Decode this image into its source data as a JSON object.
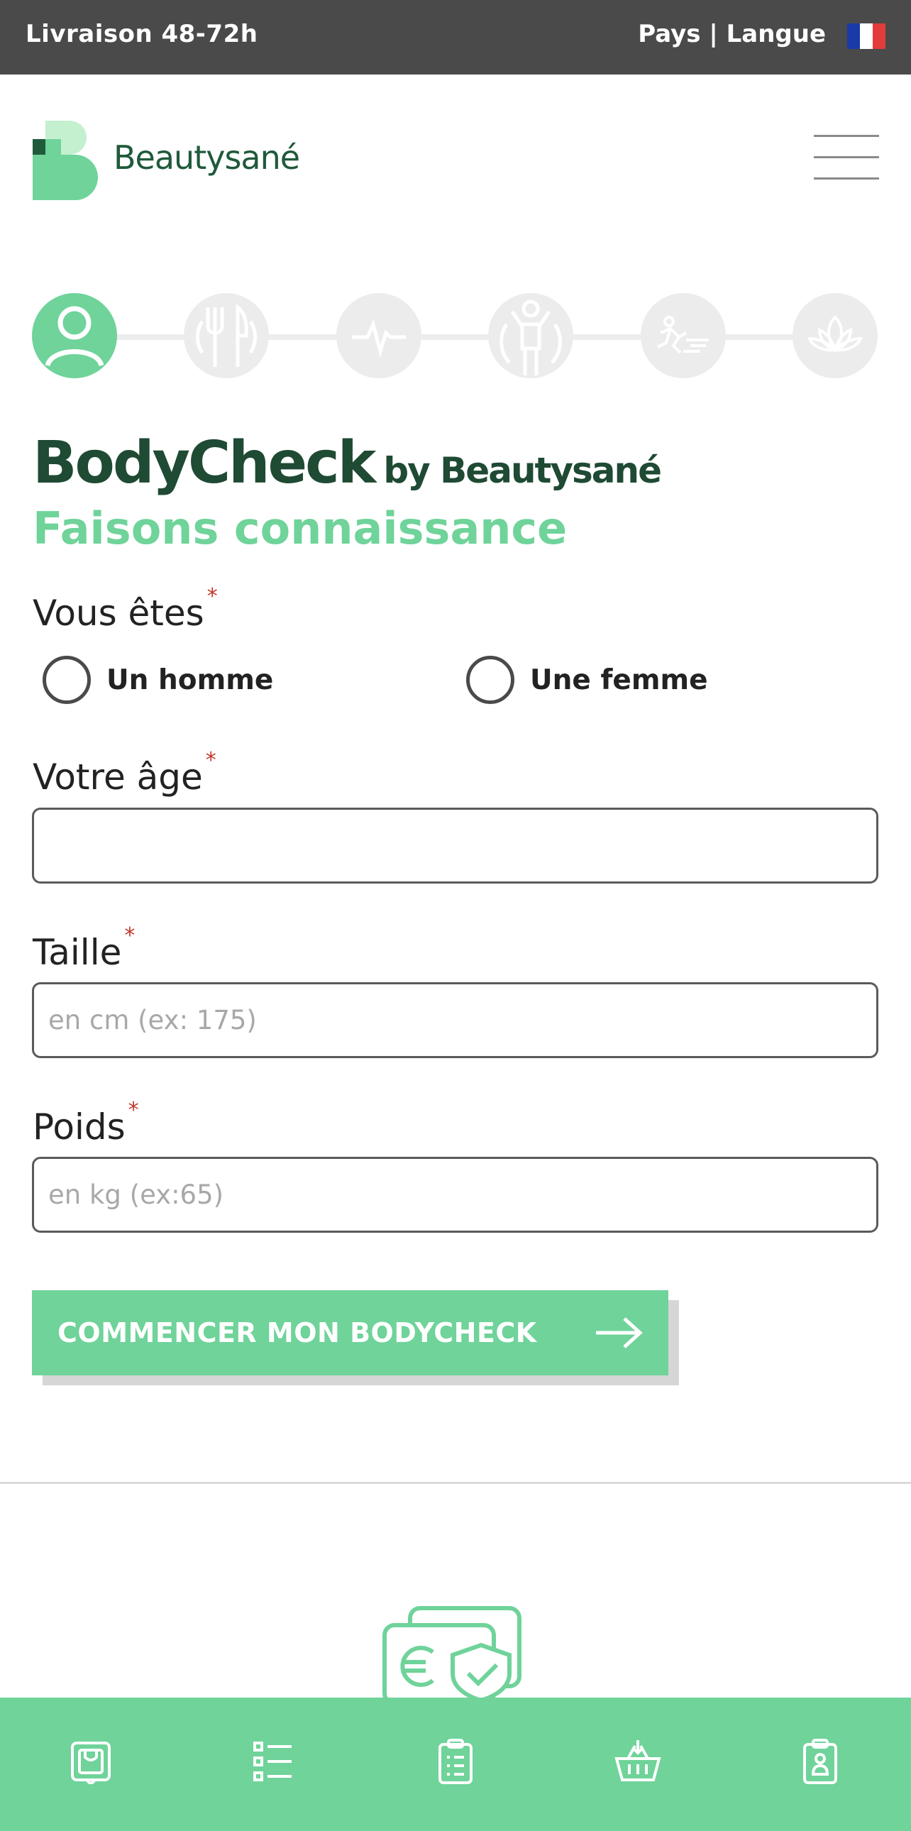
{
  "topbar": {
    "delivery": "Livraison 48-72h",
    "country_language": "Pays | Langue",
    "flag_icon": "france-flag-icon"
  },
  "header": {
    "brand": "Beautysané",
    "menu_icon": "hamburger-menu-icon"
  },
  "progress_steps": {
    "current_step": 1,
    "total_steps": 6,
    "icons": [
      "user-icon",
      "fork-knife-icon",
      "heartbeat-icon",
      "body-icon",
      "running-icon",
      "lotus-icon"
    ]
  },
  "form": {
    "title": "BodyCheck",
    "title_by": "by Beautysané",
    "subtitle": "Faisons connaissance",
    "required_mark": "*",
    "gender": {
      "label": "Vous êtes",
      "option_male": "Un homme",
      "option_female": "Une femme"
    },
    "age": {
      "label": "Votre âge",
      "value": "",
      "placeholder": ""
    },
    "height": {
      "label": "Taille",
      "value": "",
      "placeholder": "en cm (ex: 175)"
    },
    "weight": {
      "label": "Poids",
      "value": "",
      "placeholder": "en kg (ex:65)"
    },
    "submit": "COMMENCER MON BODYCHECK"
  },
  "bottom_nav": {
    "icons": [
      "shopping-bag-icon",
      "list-icon",
      "clipboard-list-icon",
      "basket-icon",
      "clipboard-user-icon"
    ]
  },
  "colors": {
    "accent": "#6fd39a",
    "dark_green": "#1f4a33",
    "topbar": "#4a4a4a",
    "required": "#c0392b"
  }
}
